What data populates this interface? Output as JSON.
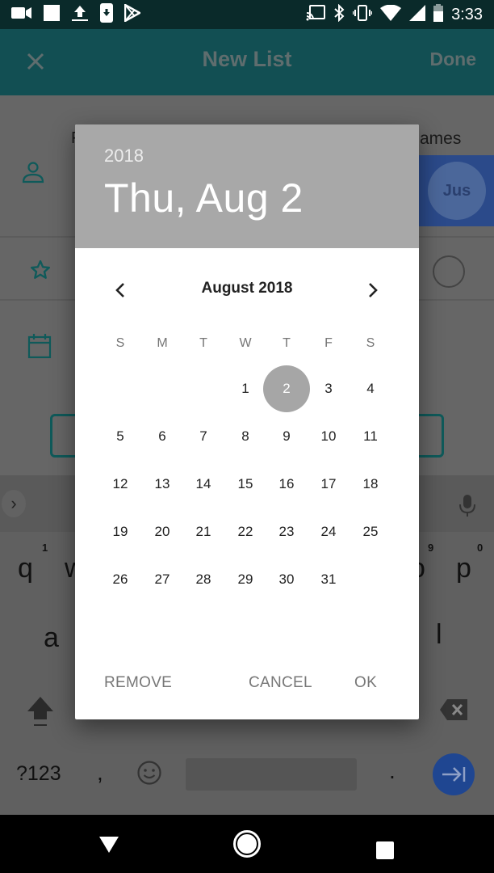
{
  "status_bar": {
    "left_icons": [
      "screen-record-icon",
      "square-notification-icon",
      "upload-icon",
      "download-phone-icon",
      "play-store-icon"
    ],
    "right_icons": [
      "cast-icon",
      "bluetooth-icon",
      "vibrate-icon",
      "wifi-icon",
      "signal-icon",
      "battery-icon"
    ],
    "time": "3:33"
  },
  "app": {
    "toolbar": {
      "close_icon": "close-icon",
      "title": "New List",
      "done_label": "Done"
    },
    "background": {
      "label_left": "F",
      "label_right": "ames",
      "avatar_text": "Jus",
      "icons": [
        "person-icon",
        "star-icon",
        "calendar-icon"
      ]
    }
  },
  "keyboard": {
    "row1": [
      {
        "key": "q",
        "hint": "1"
      },
      {
        "key": "w",
        "hint": ""
      },
      {
        "key": "o",
        "hint": "9"
      },
      {
        "key": "p",
        "hint": "0"
      }
    ],
    "row2": [
      "a",
      "l"
    ],
    "symbols_key": "?123",
    "comma_key": ",",
    "period_key": ".",
    "icons": [
      "expand-icon",
      "mic-icon",
      "shift-icon",
      "backspace-icon",
      "emoji-icon",
      "next-field-icon"
    ]
  },
  "date_picker": {
    "year": "2018",
    "selected_date_label": "Thu, Aug 2",
    "month_label": "August 2018",
    "weekdays": [
      "S",
      "M",
      "T",
      "W",
      "T",
      "F",
      "S"
    ],
    "first_weekday_index": 3,
    "days_in_month": 31,
    "selected_day": 2,
    "buttons": {
      "remove": "REMOVE",
      "cancel": "CANCEL",
      "ok": "OK"
    },
    "colors": {
      "header_bg": "#a8a8a8",
      "selected_bg": "#a6a6a6"
    }
  },
  "nav_bar": {
    "icons": [
      "back-icon",
      "home-icon",
      "recents-icon"
    ]
  }
}
